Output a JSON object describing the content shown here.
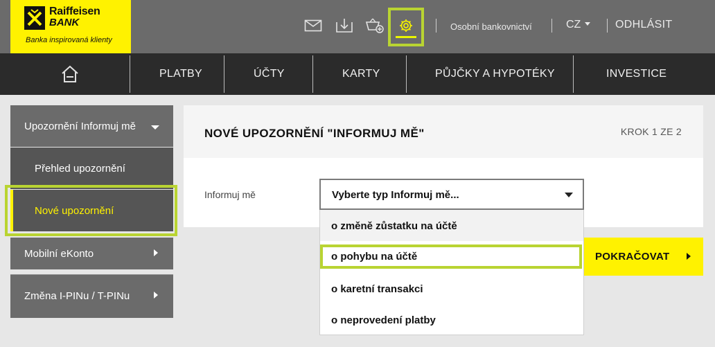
{
  "brand": {
    "name_line1": "Raiffeisen",
    "name_line2": "BANK",
    "tagline": "Banka inspirovaná klienty",
    "accent": "#fff200",
    "highlight": "#b9d432"
  },
  "header": {
    "icons": [
      "mail-icon",
      "download-icon",
      "basket-icon",
      "gear-icon"
    ],
    "segment": "Osobní bankovnictví",
    "language": "CZ",
    "logout": "ODHLÁSIT"
  },
  "nav": {
    "home_icon": "home-icon",
    "items": [
      "PLATBY",
      "ÚČTY",
      "KARTY",
      "PŮJČKY A HYPOTÉKY",
      "INVESTICE"
    ]
  },
  "sidebar": {
    "section": "Upozornění Informuj mě",
    "subitems": [
      "Přehled upozornění",
      "Nové upozornění"
    ],
    "items": [
      "Mobilní eKonto",
      "Změna I-PINu / T-PINu"
    ]
  },
  "main": {
    "title": "NOVÉ UPOZORNĚNÍ \"INFORMUJ MĚ\"",
    "step": "KROK 1 ZE 2",
    "field_label": "Informuj mě",
    "select_value": "Vyberte typ Informuj mě...",
    "options": [
      "o změně zůstatku na účtě",
      "o pohybu na účtě",
      "o karetní transakci",
      "o neprovedení platby"
    ],
    "continue_label": "POKRAČOVAT"
  }
}
